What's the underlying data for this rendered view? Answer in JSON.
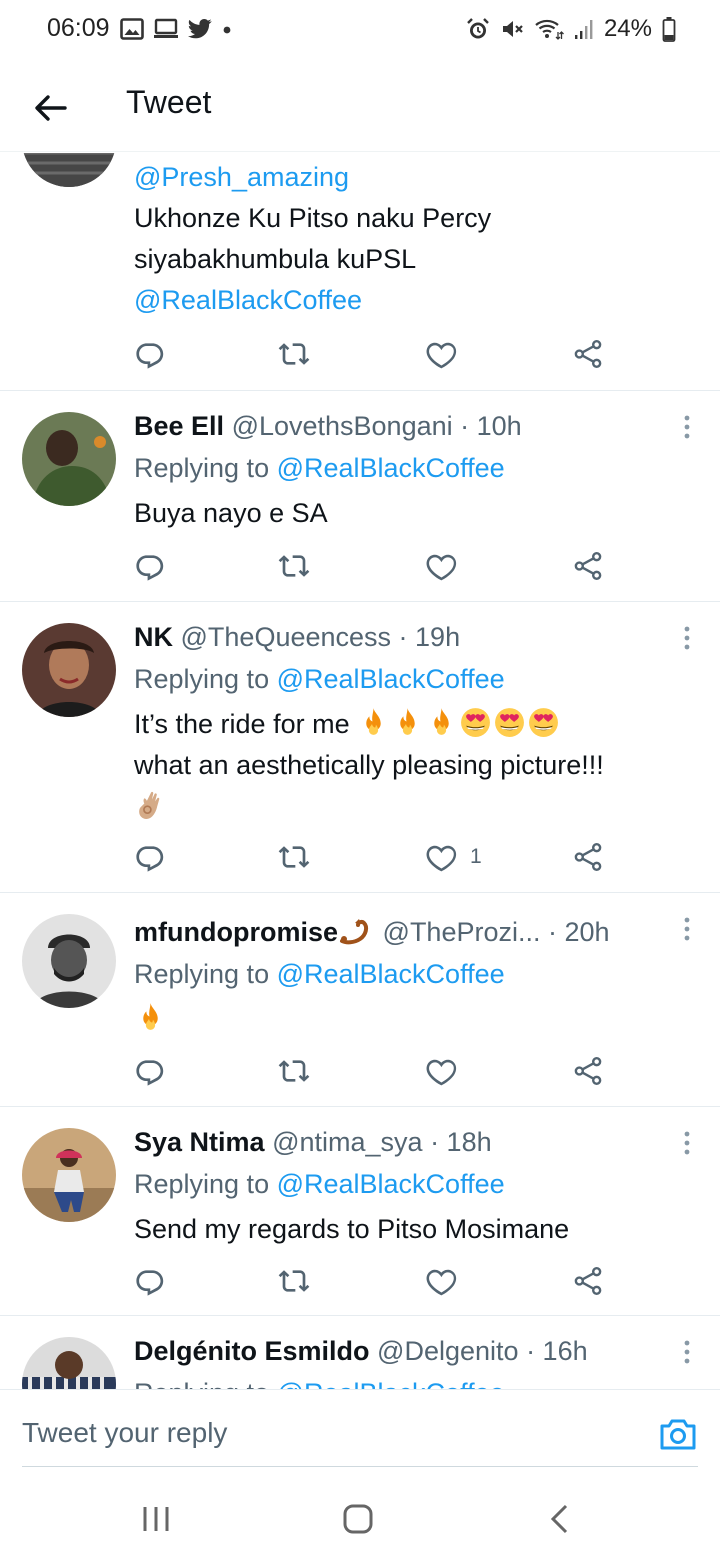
{
  "status_bar": {
    "time": "06:09",
    "battery": "24%",
    "left_icons": [
      "gallery-icon",
      "monitor-icon",
      "twitter-bird-icon",
      "dot-icon"
    ],
    "right_icons": [
      "alarm-icon",
      "mute-icon",
      "wifi-icon",
      "signal-icon",
      "battery-icon"
    ]
  },
  "header": {
    "title": "Tweet",
    "back_icon": "arrow-left-icon"
  },
  "tweets": [
    {
      "mention": "@Presh_amazing",
      "text_line1": "Ukhonze Ku Pitso naku Percy",
      "text_line2": "siyabakhumbula kuPSL",
      "text_mention": "@RealBlackCoffee"
    },
    {
      "name": "Bee Ell",
      "handle": "@LovethsBongani",
      "time": "· 10h",
      "replying_prefix": "Replying to ",
      "replying_to": "@RealBlackCoffee",
      "text": "Buya nayo e SA"
    },
    {
      "name": "NK",
      "handle": "@TheQueencess",
      "time": "· 19h",
      "replying_prefix": "Replying to ",
      "replying_to": "@RealBlackCoffee",
      "text_line1": "It’s the ride for me ",
      "text_line2": "what an aesthetically pleasing picture!!!",
      "like_count": "1"
    },
    {
      "name": "mfundopromise",
      "handle": "@TheProzi...",
      "time": "· 20h",
      "replying_prefix": "Replying to ",
      "replying_to": "@RealBlackCoffee"
    },
    {
      "name": "Sya Ntima",
      "handle": "@ntima_sya",
      "time": "· 18h",
      "replying_prefix": "Replying to ",
      "replying_to": "@RealBlackCoffee",
      "text": "Send my regards to Pitso Mosimane"
    },
    {
      "name": "Delgénito Esmildo",
      "handle": "@Delgenito",
      "time": "· 16h",
      "replying_prefix": "Replying to ",
      "replying_to": "@RealBlackCoffee"
    }
  ],
  "actions": [
    "reply-icon",
    "retweet-icon",
    "like-icon",
    "share-icon"
  ],
  "reply_bar": {
    "placeholder": "Tweet your reply",
    "camera_icon": "camera-icon"
  },
  "nav_bar": [
    "recent-apps-icon",
    "home-icon",
    "back-icon"
  ],
  "colors": {
    "accent": "#1d9bf0",
    "text": "#0f1419",
    "secondary": "#536471",
    "divider": "#e6ecf0"
  }
}
